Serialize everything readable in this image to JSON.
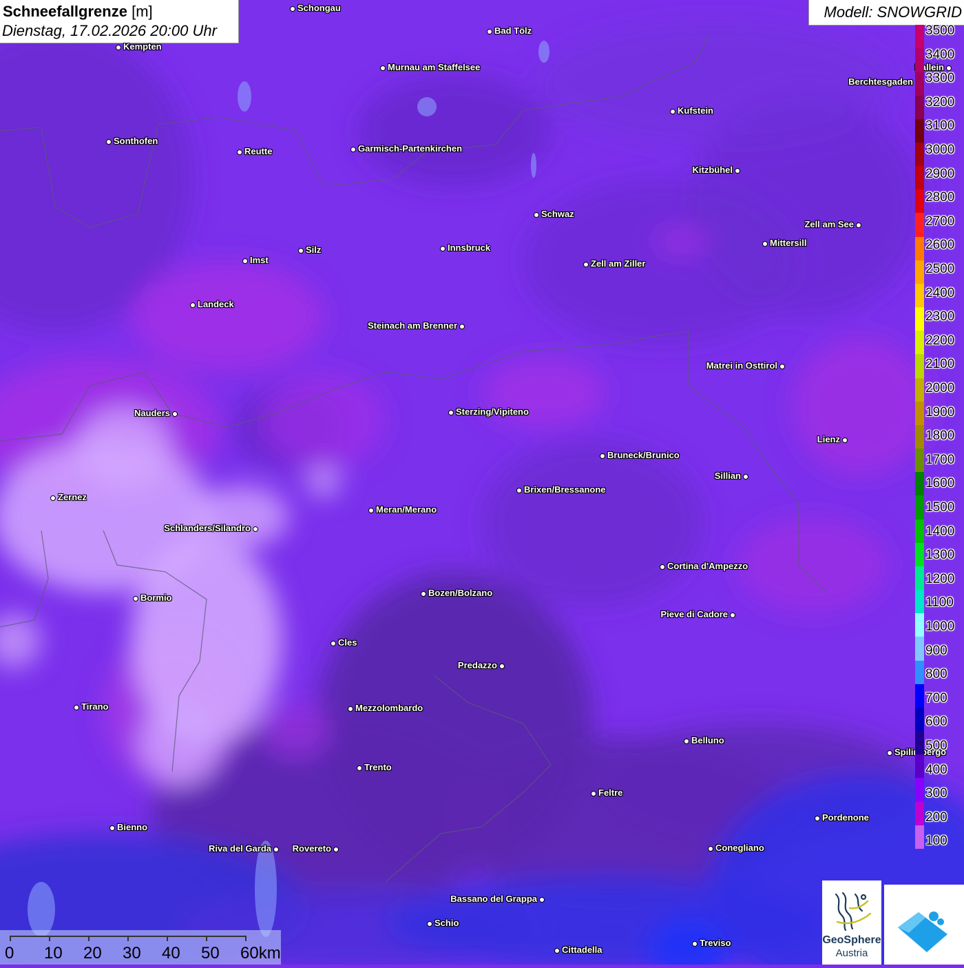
{
  "title": {
    "main": "Schneefallgrenze",
    "unit": "[m]",
    "datetime": "Dienstag, 17.02.2026 20:00 Uhr"
  },
  "model": "Modell: SNOWGRID",
  "cities": [
    {
      "name": "Schongau",
      "side": "r"
    },
    {
      "name": "Bad Tölz",
      "side": "r"
    },
    {
      "name": "Kempten",
      "side": "r"
    },
    {
      "name": "Murnau am Staffelsee",
      "side": "r"
    },
    {
      "name": "Berchtesgaden",
      "side": "l"
    },
    {
      "name": "Kufstein",
      "side": "r"
    },
    {
      "name": "Sonthofen",
      "side": "r"
    },
    {
      "name": "Reutte",
      "side": "r"
    },
    {
      "name": "Garmisch-Partenkirchen",
      "side": "r"
    },
    {
      "name": "Kitzbühel",
      "side": "l"
    },
    {
      "name": "Schwaz",
      "side": "r"
    },
    {
      "name": "Zell am See",
      "side": "l"
    },
    {
      "name": "Mittersill",
      "side": "r"
    },
    {
      "name": "Innsbruck",
      "side": "r"
    },
    {
      "name": "Silz",
      "side": "r"
    },
    {
      "name": "Imst",
      "side": "r"
    },
    {
      "name": "Zell am Ziller",
      "side": "r"
    },
    {
      "name": "Landeck",
      "side": "r"
    },
    {
      "name": "Steinach am Brenner",
      "side": "l"
    },
    {
      "name": "Matrei in Osttirol",
      "side": "l"
    },
    {
      "name": "Nauders",
      "side": "l"
    },
    {
      "name": "Sterzing/Vipiteno",
      "side": "r"
    },
    {
      "name": "Lienz",
      "side": "l"
    },
    {
      "name": "Bruneck/Brunico",
      "side": "r"
    },
    {
      "name": "Sillian",
      "side": "l"
    },
    {
      "name": "Zernez",
      "side": "r"
    },
    {
      "name": "Brixen/Bressanone",
      "side": "r"
    },
    {
      "name": "Meran/Merano",
      "side": "r"
    },
    {
      "name": "Schlanders/Silandro",
      "side": "l"
    },
    {
      "name": "Cortina d'Ampezzo",
      "side": "r"
    },
    {
      "name": "Bozen/Bolzano",
      "side": "r"
    },
    {
      "name": "Bormio",
      "side": "r"
    },
    {
      "name": "Pieve di Cadore",
      "side": "l"
    },
    {
      "name": "Cles",
      "side": "r"
    },
    {
      "name": "Predazzo",
      "side": "l"
    },
    {
      "name": "Tirano",
      "side": "r"
    },
    {
      "name": "Mezzolombardo",
      "side": "r"
    },
    {
      "name": "Belluno",
      "side": "r"
    },
    {
      "name": "Spilimbergo",
      "side": "r"
    },
    {
      "name": "Trento",
      "side": "r"
    },
    {
      "name": "Feltre",
      "side": "r"
    },
    {
      "name": "Pordenone",
      "side": "r"
    },
    {
      "name": "Bienno",
      "side": "r"
    },
    {
      "name": "Riva del Garda",
      "side": "l"
    },
    {
      "name": "Rovereto",
      "side": "l"
    },
    {
      "name": "Conegliano",
      "side": "r"
    },
    {
      "name": "Bassano del Grappa",
      "side": "l"
    },
    {
      "name": "Schio",
      "side": "r"
    },
    {
      "name": "Treviso",
      "side": "r"
    },
    {
      "name": "Cittadella",
      "side": "r"
    },
    {
      "name": "Hallein",
      "side": "l"
    }
  ],
  "legend": {
    "labels": [
      "3500",
      "3400",
      "3300",
      "3200",
      "3100",
      "3000",
      "2900",
      "2800",
      "2700",
      "2600",
      "2500",
      "2400",
      "2300",
      "2200",
      "2100",
      "2000",
      "1900",
      "1800",
      "1700",
      "1600",
      "1500",
      "1400",
      "1300",
      "1200",
      "1100",
      "1000",
      "900",
      "800",
      "700",
      "600",
      "500",
      "400",
      "300",
      "200",
      "100"
    ],
    "colors": [
      "#c8006e",
      "#b5006a",
      "#a00060",
      "#8a0050",
      "#700010",
      "#a00010",
      "#c00010",
      "#e00010",
      "#ff2020",
      "#ff7a00",
      "#ffa500",
      "#ffc800",
      "#ffff00",
      "#d8f000",
      "#b8d800",
      "#c0b000",
      "#c09000",
      "#a08a00",
      "#6a9000",
      "#008000",
      "#009a00",
      "#00c000",
      "#00e020",
      "#00e890",
      "#00e8c8",
      "#90ffff",
      "#80c8ff",
      "#3090ff",
      "#0000ff",
      "#0000c0",
      "#200090",
      "#5a00c8",
      "#8a00ff",
      "#c000d0",
      "#c860f0"
    ]
  },
  "scale": {
    "ticks": [
      "0",
      "10",
      "20",
      "30",
      "40",
      "50",
      "60km"
    ]
  },
  "logos": {
    "geosphere_line1": "GeoSphere",
    "geosphere_line2": "Austria"
  }
}
